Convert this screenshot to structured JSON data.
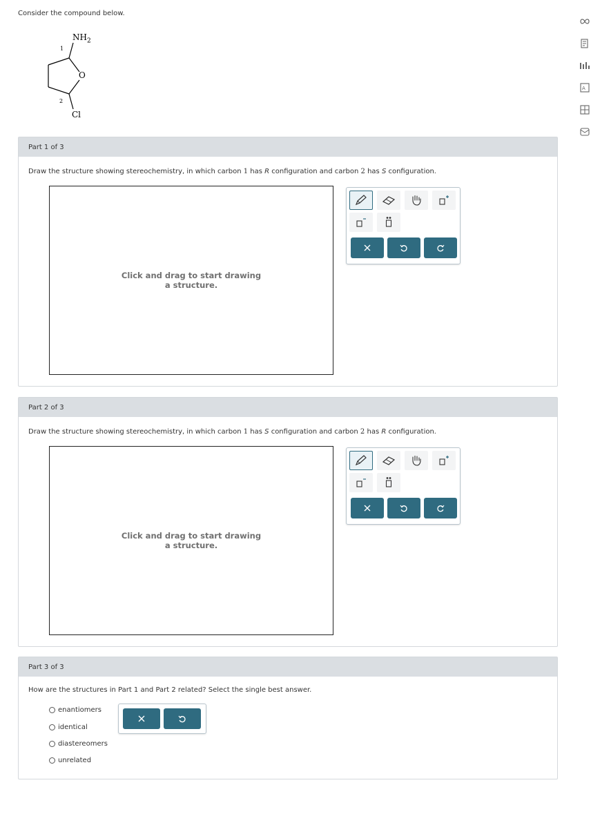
{
  "prompt": "Consider the compound below.",
  "molecule": {
    "label_nh": "NH",
    "label_nh_sub": "2",
    "label_o": "O",
    "label_cl": "Cl",
    "num1": "1",
    "num2": "2"
  },
  "parts": [
    {
      "header": "Part 1 of 3",
      "q_a": "Draw the structure showing stereochemistry, in which carbon ",
      "q_c1": "1",
      "q_b": " has ",
      "q_cfg1": "R",
      "q_c": " configuration and carbon ",
      "q_c2": "2",
      "q_d": " has ",
      "q_cfg2": "S",
      "q_e": " configuration.",
      "hint": "Click and drag to start drawing a structure."
    },
    {
      "header": "Part 2 of 3",
      "q_a": "Draw the structure showing stereochemistry, in which carbon ",
      "q_c1": "1",
      "q_b": " has ",
      "q_cfg1": "S",
      "q_c": " configuration and carbon ",
      "q_c2": "2",
      "q_d": " has ",
      "q_cfg2": "R",
      "q_e": " configuration.",
      "hint": "Click and drag to start drawing a structure."
    },
    {
      "header": "Part 3 of 3",
      "question": "How are the structures in Part 1 and Part 2 related? Select the single best answer.",
      "options": [
        "enantiomers",
        "identical",
        "diastereomers",
        "unrelated"
      ]
    }
  ],
  "icons": {
    "pencil": "pencil-icon",
    "eraser": "eraser-icon",
    "hand": "hand-icon",
    "charge_plus": "charge-plus-icon",
    "charge_minus": "charge-minus-icon",
    "lone_pair": "lone-pair-icon",
    "clear": "x-icon",
    "undo": "undo-icon",
    "redo": "redo-icon"
  },
  "colors": {
    "accent": "#2f6b80",
    "header_bg": "#dadee2"
  }
}
